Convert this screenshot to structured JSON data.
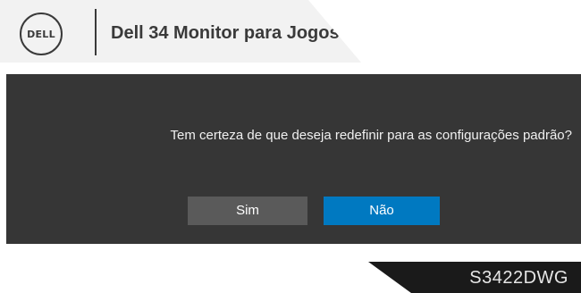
{
  "header": {
    "logo_text": "DELL",
    "title": "Dell 34 Monitor para Jogos"
  },
  "dialog": {
    "message": "Tem certeza de que deseja redefinir para as configurações padrão?",
    "yes_label": "Sim",
    "no_label": "Não",
    "selected": "no"
  },
  "footer": {
    "model": "S3422DWG"
  },
  "colors": {
    "header_bg": "#f2f2f2",
    "dialog_bg": "#363636",
    "button_neutral": "#5a5a5a",
    "button_selected": "#0079c1",
    "model_tab_bg": "#1a1a1a"
  },
  "icons": {
    "logo": "dell-logo"
  }
}
